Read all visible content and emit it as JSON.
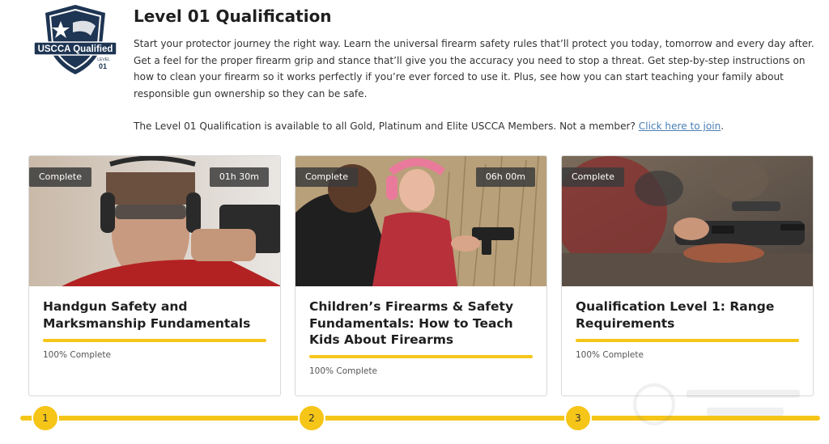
{
  "header": {
    "logo": {
      "icon": "uscca-shield-logo",
      "text_main": "USCCA Qualified",
      "text_level": "LEVEL",
      "text_num": "01"
    },
    "title": "Level 01 Qualification",
    "description": "Start your protector journey the right way. Learn the universal firearm safety rules that’ll protect you today, tomorrow and every day after. Get a feel for the proper firearm grip and stance that’ll give you the accuracy you need to stop a threat. Get step-by-step instructions on how to clean your firearm so it works perfectly if you’re ever forced to use it. Plus, see how you can start teaching your family about responsible gun ownership so they can be safe.",
    "availability_text": "The Level 01 Qualification is available to all Gold, Platinum and Elite USCCA Members. Not a member?",
    "join_link": "Click here to join",
    "join_suffix": "."
  },
  "cards": [
    {
      "status": "Complete",
      "duration": "01h 30m",
      "title": "Handgun Safety and Marksmanship Fundamentals",
      "progress_text": "100% Complete",
      "progress": 1.0
    },
    {
      "status": "Complete",
      "duration": "06h 00m",
      "title": "Children’s Firearms & Safety Fundamentals: How to Teach Kids About Firearms",
      "progress_text": "100% Complete",
      "progress": 1.0
    },
    {
      "status": "Complete",
      "duration": "",
      "title": "Qualification Level 1: Range Requirements",
      "progress_text": "100% Complete",
      "progress": 1.0
    }
  ],
  "steps": [
    "1",
    "2",
    "3"
  ],
  "colors": {
    "accent": "#f5c518",
    "link": "#4a7fb5",
    "tag_bg": "#3c3c3c",
    "logo_navy": "#1e3553"
  }
}
